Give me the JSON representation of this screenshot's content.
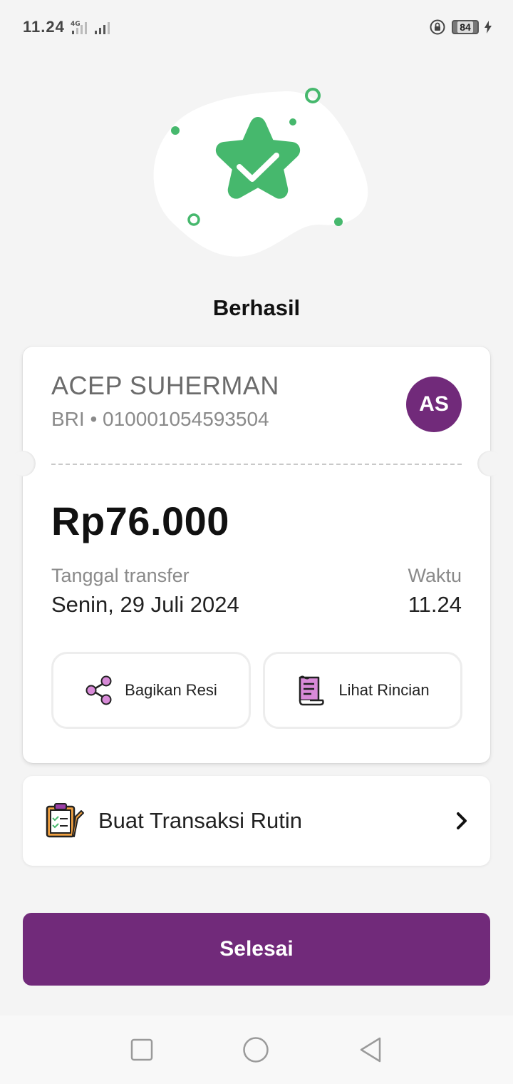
{
  "status_bar": {
    "time": "11.24",
    "network": "4G",
    "battery_level": "84"
  },
  "result": {
    "title": "Berhasil",
    "icon": "star-check-icon"
  },
  "recipient": {
    "name": "ACEP SUHERMAN",
    "account": "BRI • 010001054593504",
    "initials": "AS"
  },
  "transfer": {
    "amount": "Rp76.000",
    "date_label": "Tanggal transfer",
    "date_value": "Senin, 29 Juli 2024",
    "time_label": "Waktu",
    "time_value": "11.24"
  },
  "actions": {
    "share_label": "Bagikan Resi",
    "detail_label": "Lihat Rincian"
  },
  "routine": {
    "label": "Buat Transaksi Rutin"
  },
  "done_button": {
    "label": "Selesai"
  },
  "colors": {
    "brand_purple": "#712a7a",
    "success_green": "#46b86d",
    "icon_pink": "#d88ad8"
  }
}
